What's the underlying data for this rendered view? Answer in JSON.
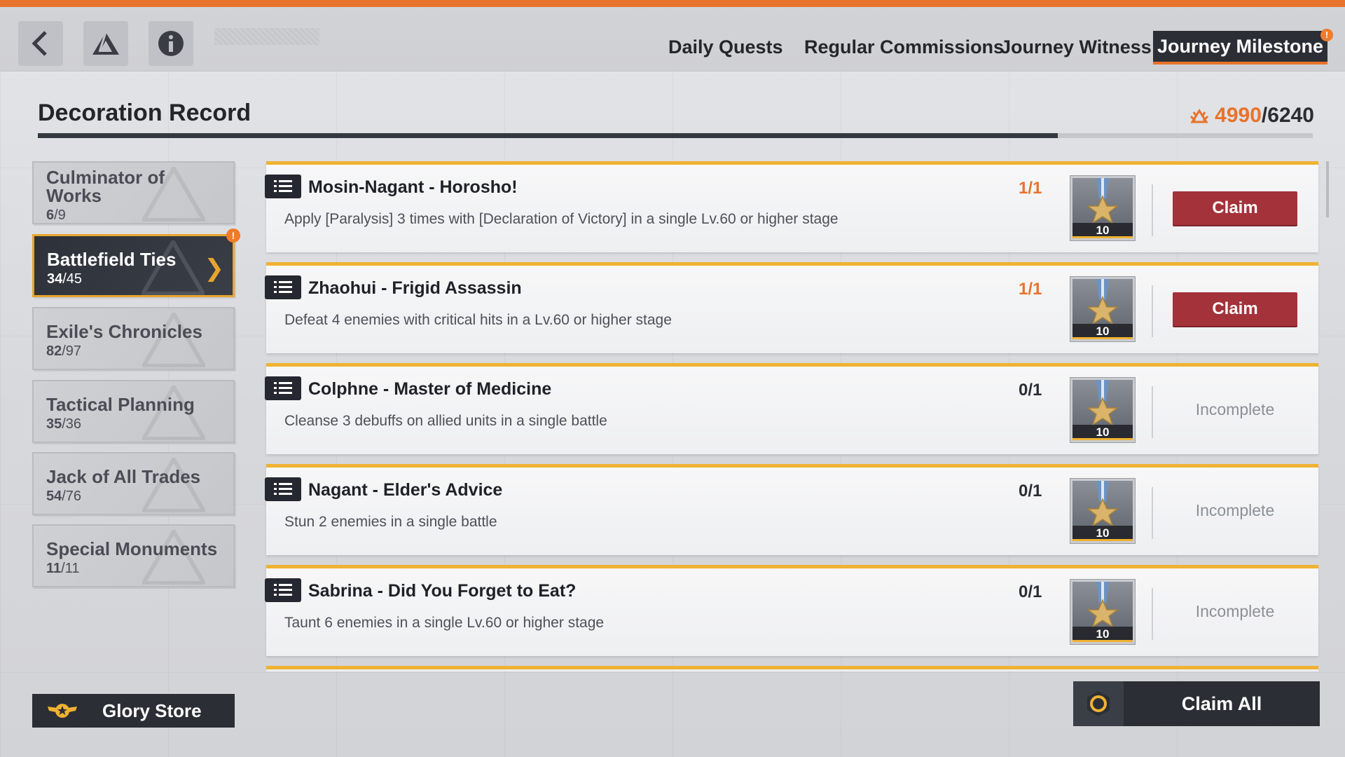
{
  "header": {
    "tabs": [
      {
        "label": "Daily Quests",
        "active": false
      },
      {
        "label": "Regular Commissions",
        "active": false
      },
      {
        "label": "Journey Witness",
        "active": false
      },
      {
        "label": "Journey Milestone",
        "active": true,
        "badge": "!"
      }
    ]
  },
  "panel": {
    "title": "Decoration Record",
    "score_current": "4990",
    "score_total": "/6240",
    "progress_fraction": 0.8
  },
  "sidebar": {
    "items": [
      {
        "name": "Culminator of Works",
        "done": "6",
        "total": "/9",
        "active": false
      },
      {
        "name": "Battlefield Ties",
        "done": "34",
        "total": "/45",
        "active": true,
        "badge": "!"
      },
      {
        "name": "Exile's Chronicles",
        "done": "82",
        "total": "/97",
        "active": false
      },
      {
        "name": "Tactical Planning",
        "done": "35",
        "total": "/36",
        "active": false
      },
      {
        "name": "Jack of All Trades",
        "done": "54",
        "total": "/76",
        "active": false
      },
      {
        "name": "Special Monuments",
        "done": "11",
        "total": "/11",
        "active": false
      }
    ],
    "glory_store": "Glory Store"
  },
  "quests": [
    {
      "title": "Mosin-Nagant - Horosho!",
      "desc": "Apply [Paralysis] 3 times with [Declaration of Victory] in a single Lv.60 or higher stage",
      "progress": "1/1",
      "complete": true,
      "reward_qty": "10",
      "action": "Claim"
    },
    {
      "title": "Zhaohui - Frigid Assassin",
      "desc": "Defeat 4 enemies with critical hits in a Lv.60 or higher stage",
      "progress": "1/1",
      "complete": true,
      "reward_qty": "10",
      "action": "Claim"
    },
    {
      "title": "Colphne - Master of Medicine",
      "desc": "Cleanse 3 debuffs on allied units in a single battle",
      "progress": "0/1",
      "complete": false,
      "reward_qty": "10",
      "action": "Incomplete"
    },
    {
      "title": "Nagant - Elder's Advice",
      "desc": "Stun 2 enemies in a single battle",
      "progress": "0/1",
      "complete": false,
      "reward_qty": "10",
      "action": "Incomplete"
    },
    {
      "title": "Sabrina - Did You Forget to Eat?",
      "desc": "Taunt 6 enemies in a single Lv.60 or higher stage",
      "progress": "0/1",
      "complete": false,
      "reward_qty": "10",
      "action": "Incomplete"
    }
  ],
  "footer": {
    "claim_all": "Claim All"
  },
  "colors": {
    "accent_orange": "#e7732d",
    "accent_gold": "#f0b232",
    "claim_red": "#a3323a",
    "dark": "#2b2e35"
  },
  "icons": {
    "back": "back-arrow-icon",
    "logo": "triangle-logo-icon",
    "info": "info-icon",
    "quest": "list-icon",
    "medal": "medal-icon",
    "glory": "winged-star-icon",
    "claim_all": "ring-icon"
  }
}
